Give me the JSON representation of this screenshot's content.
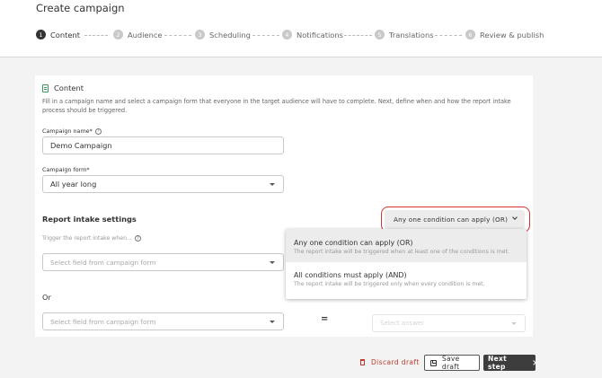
{
  "page": {
    "title": "Create campaign"
  },
  "steps": [
    {
      "num": "1",
      "label": "Content",
      "active": true
    },
    {
      "num": "2",
      "label": "Audience",
      "active": false
    },
    {
      "num": "3",
      "label": "Scheduling",
      "active": false
    },
    {
      "num": "4",
      "label": "Notifications",
      "active": false
    },
    {
      "num": "5",
      "label": "Translations",
      "active": false
    },
    {
      "num": "6",
      "label": "Review & publish",
      "active": false
    }
  ],
  "content": {
    "section_title": "Content",
    "description": "Fill in a campaign name and select a campaign form that everyone in the target audience will have to complete. Next, define when and how the report intake process should be triggered.",
    "campaign_name_label": "Campaign name*",
    "campaign_name_value": "Demo Campaign",
    "campaign_form_label": "Campaign form*",
    "campaign_form_value": "All year long"
  },
  "report_intake": {
    "title": "Report intake settings",
    "trigger_label": "Trigger the report intake when...",
    "field_placeholder": "Select field from campaign form",
    "or_label": "Or",
    "equals": "=",
    "answer_placeholder": "Select answer",
    "condition_button": "Any one condition can apply (OR)"
  },
  "dropdown": {
    "options": [
      {
        "title": "Any one condition can apply (OR)",
        "desc": "The report intake will be triggered when at least one of the conditions is met.",
        "selected": true
      },
      {
        "title": "All conditions must apply (AND)",
        "desc": "The report intake will be triggered only when every condition is met.",
        "selected": false
      }
    ]
  },
  "footer": {
    "discard_label": "Discard draft",
    "save_label": "Save draft",
    "next_label": "Next step"
  },
  "colors": {
    "accent_green": "#3a9a5b",
    "highlight_red": "#d63232",
    "danger": "#c0392b",
    "primary_dark": "#3d3d3d"
  },
  "icons": [
    "help-icon",
    "document-icon",
    "chevron-down-icon",
    "trash-icon",
    "save-icon",
    "chevron-right-icon"
  ]
}
